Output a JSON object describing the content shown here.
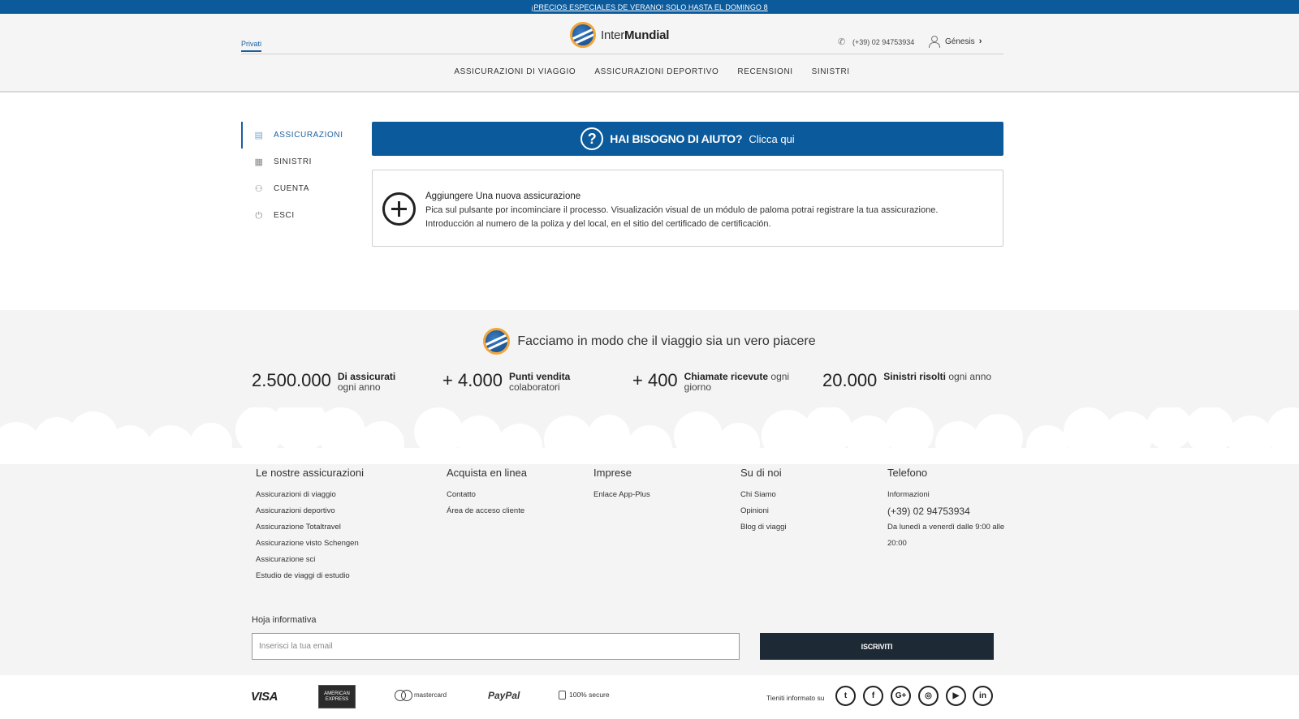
{
  "promo": {
    "text": "¡PRECIOS ESPECIALES DE VERANO! SOLO HASTA EL DOMINGO 8"
  },
  "header": {
    "segment": "Privati",
    "logo": {
      "prefix": "Inter",
      "bold": "Mundial"
    },
    "phone": "(+39) 02 94753934",
    "user": "Génesis",
    "nav": [
      "ASSICURAZIONI DI VIAGGIO",
      "ASSICURAZIONI DEPORTIVO",
      "RECENSIONI",
      "SINISTRI"
    ]
  },
  "sidebar": {
    "items": [
      {
        "label": "ASSICURAZIONI",
        "icon": "document-icon",
        "active": true
      },
      {
        "label": "SINISTRI",
        "icon": "newspaper-icon",
        "active": false
      },
      {
        "label": "CUENTA",
        "icon": "user-icon",
        "active": false
      },
      {
        "label": "ESCI",
        "icon": "power-icon",
        "active": false
      }
    ]
  },
  "help": {
    "title": "HAI BISOGNO DI AIUTO?",
    "link": "Clicca qui"
  },
  "add_card": {
    "title": "Aggiungere Una nuova assicurazione",
    "line1": "Pica sul pulsante por incominciare il processo. Visualización visual de un módulo de paloma potrai registrare la tua assicurazione.",
    "line2": "Introducción al numero de la poliza y del local, en el sitio del certificado de certificación."
  },
  "stats": {
    "tagline": "Facciamo in modo che il viaggio sia un vero piacere",
    "items": [
      {
        "number": "2.500.000",
        "bold": "Di assicurati",
        "rest": "ogni anno"
      },
      {
        "number": "+ 4.000",
        "bold": "Punti vendita",
        "rest": "colaboratori"
      },
      {
        "number": "+ 400",
        "bold": "Chiamate ricevute",
        "rest": "ogni giorno"
      },
      {
        "number": "20.000",
        "bold": "Sinistri risolti",
        "rest": "ogni anno"
      }
    ]
  },
  "footer": {
    "columns": [
      {
        "title": "Le nostre assicurazioni",
        "links": [
          "Assicurazioni di viaggio",
          "Assicurazioni deportivo",
          "Assicurazione Totaltravel",
          "Assicurazione visto Schengen",
          "Assicurazione sci",
          "Estudio de viaggi di estudio"
        ]
      },
      {
        "title": "Acquista en linea",
        "links": [
          "Contatto",
          "Área de acceso cliente"
        ]
      },
      {
        "title": "Imprese",
        "links": [
          "Enlace App-Plus"
        ]
      },
      {
        "title": "Su di noi",
        "links": [
          "Chi Siamo",
          "Opinioni",
          "Blog di viaggi"
        ]
      },
      {
        "title": "Telefono",
        "info": "Informazioni",
        "phone": "(+39) 02 94753934",
        "hours": "Da lunedì a venerdì dalle 9:00 alle 20:00"
      }
    ]
  },
  "newsletter": {
    "title": "Hoja informativa",
    "placeholder": "Inserisci la tua email",
    "button": "ISCRIVITI"
  },
  "payments": {
    "visa": "VISA",
    "amex": "AMERICAN EXPRESS",
    "mastercard": "mastercard",
    "paypal": "PayPal",
    "secure": "100% secure"
  },
  "social": {
    "label": "Tieniti informato su",
    "items": [
      {
        "name": "twitter-icon",
        "glyph": "t"
      },
      {
        "name": "facebook-icon",
        "glyph": "f"
      },
      {
        "name": "google-plus-icon",
        "glyph": "G+"
      },
      {
        "name": "instagram-icon",
        "glyph": "◎"
      },
      {
        "name": "youtube-icon",
        "glyph": "▶"
      },
      {
        "name": "linkedin-icon",
        "glyph": "in"
      }
    ]
  },
  "colors": {
    "brand_blue": "#0a5a9c",
    "logo_orange": "#f2a53a",
    "button_dark": "#1d2a35",
    "panel_gray": "#f4f4f4"
  }
}
